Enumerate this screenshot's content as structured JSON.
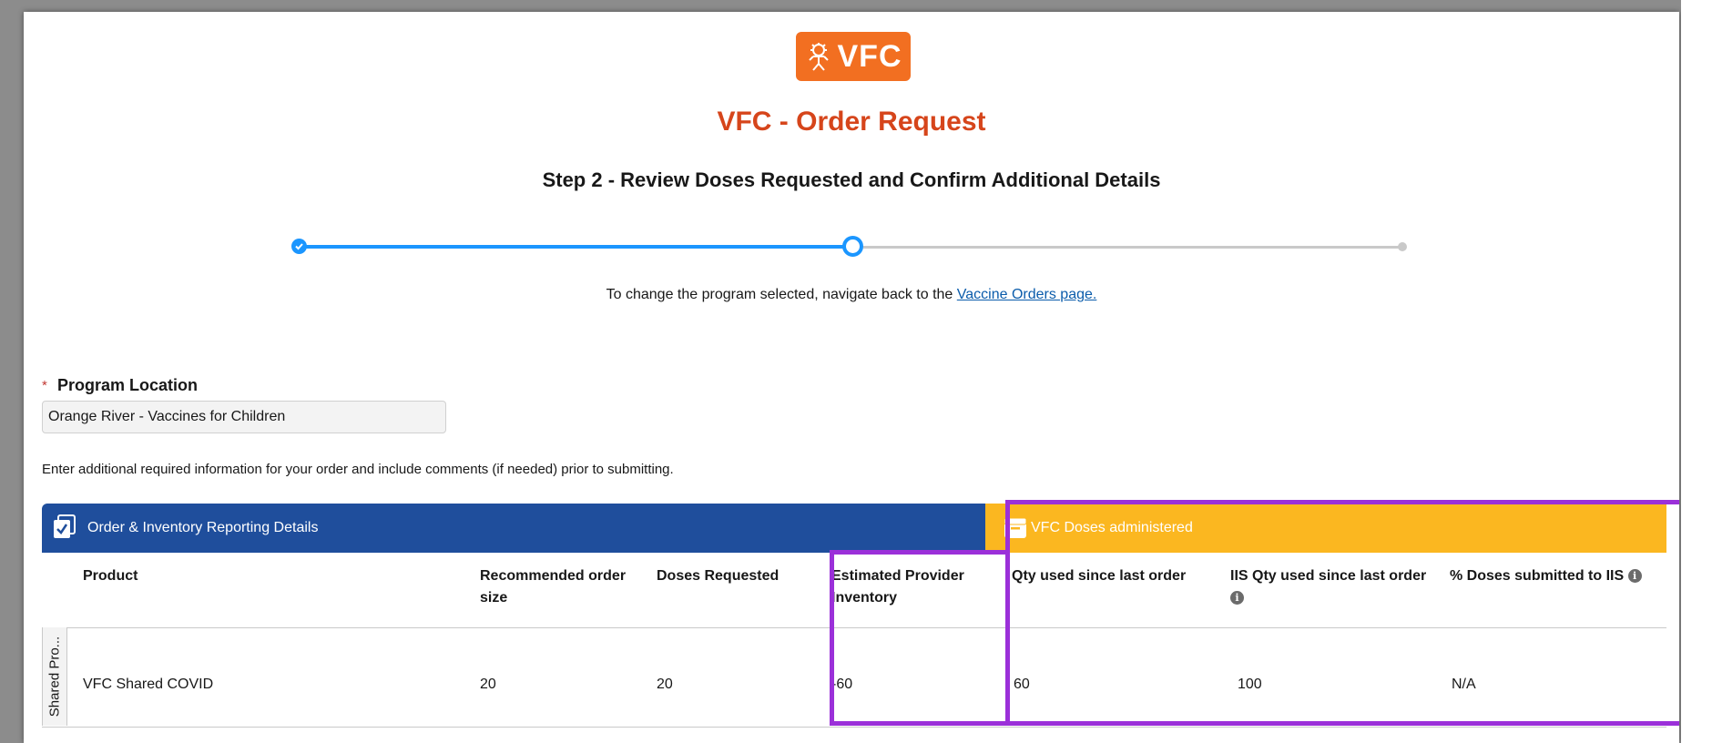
{
  "app": {
    "logo_text": "VFC",
    "title": "VFC - Order Request",
    "subtitle": "Step 2 - Review Doses Requested and Confirm Additional Details"
  },
  "stepper": {
    "steps": [
      {
        "state": "complete"
      },
      {
        "state": "current"
      },
      {
        "state": "upcoming"
      }
    ]
  },
  "change_note": {
    "text": "To change the program selected, navigate back to the ",
    "link": "Vaccine Orders page."
  },
  "program_location": {
    "required_marker": "*",
    "label": "Program Location",
    "value": "Orange River - Vaccines for Children"
  },
  "instructions": "Enter additional required information for your order and include comments (if needed) prior to submitting.",
  "table": {
    "section_blue": "Order & Inventory Reporting Details",
    "section_yellow": "VFC Doses administered",
    "columns": {
      "product": "Product",
      "recommended_1": "Recommended order",
      "recommended_2": "size",
      "doses_requested": "Doses Requested",
      "estimated_1": "Estimated Provider",
      "estimated_2": "Inventory",
      "qty_used": "Qty used since last order",
      "iis_qty": "IIS Qty used since last order",
      "pct_submitted": "% Doses submitted to IIS"
    },
    "rows": [
      {
        "group": "Shared Pro...",
        "product": "VFC Shared COVID",
        "recommended": "20",
        "doses_requested": "20",
        "estimated_inventory": "-60",
        "qty_used": "60",
        "iis_qty": "100",
        "pct_submitted": "N/A"
      }
    ]
  },
  "colors": {
    "brand_orange": "#f26f21",
    "title_red": "#d6451b",
    "header_blue": "#1f4e9c",
    "header_yellow": "#fbb720",
    "highlight_purple": "#9b30d9",
    "step_blue": "#1b96ff"
  }
}
